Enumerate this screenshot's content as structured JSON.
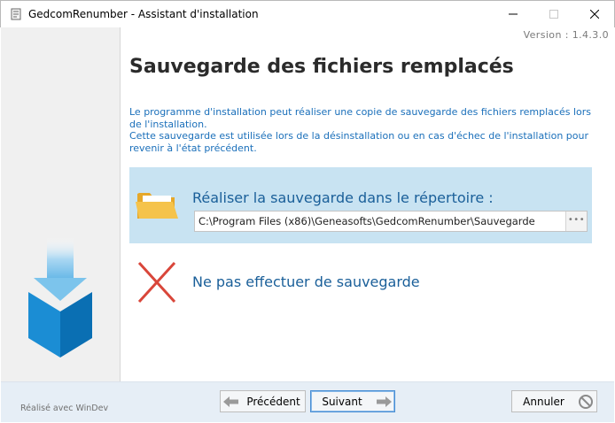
{
  "window": {
    "title": "GedcomRenumber - Assistant d'installation",
    "controls": [
      "minimize-icon",
      "maximize-icon",
      "close-icon"
    ]
  },
  "version": "Version : 1.4.3.0",
  "page": {
    "title": "Sauvegarde des fichiers remplacés",
    "description": [
      "Le programme d'installation peut réaliser une copie de sauvegarde des fichiers remplacés lors de l'installation.",
      "Cette sauvegarde est utilisée lors de la désinstallation ou en cas d'échec de l'installation pour revenir à l'état précédent."
    ]
  },
  "options": {
    "backup": {
      "label": "Réaliser la sauvegarde dans le répertoire :",
      "icon": "folder-icon",
      "path": "C:\\Program Files (x86)\\Geneasofts\\GedcomRenumber\\Sauvegarde",
      "browse": "•••",
      "selected": true
    },
    "no_backup": {
      "label": "Ne pas effectuer de sauvegarde",
      "icon": "cross-icon",
      "selected": false
    }
  },
  "footer": {
    "made_with": "Réalisé avec WinDev",
    "prev_label": "Précédent",
    "next_label": "Suivant",
    "cancel_label": "Annuler"
  },
  "colors": {
    "accent": "#1a5f99",
    "selected_bg": "#c8e3f2",
    "footer_bg": "#e6eef6",
    "cross": "#d9463a",
    "folder": "#f0b73c"
  }
}
